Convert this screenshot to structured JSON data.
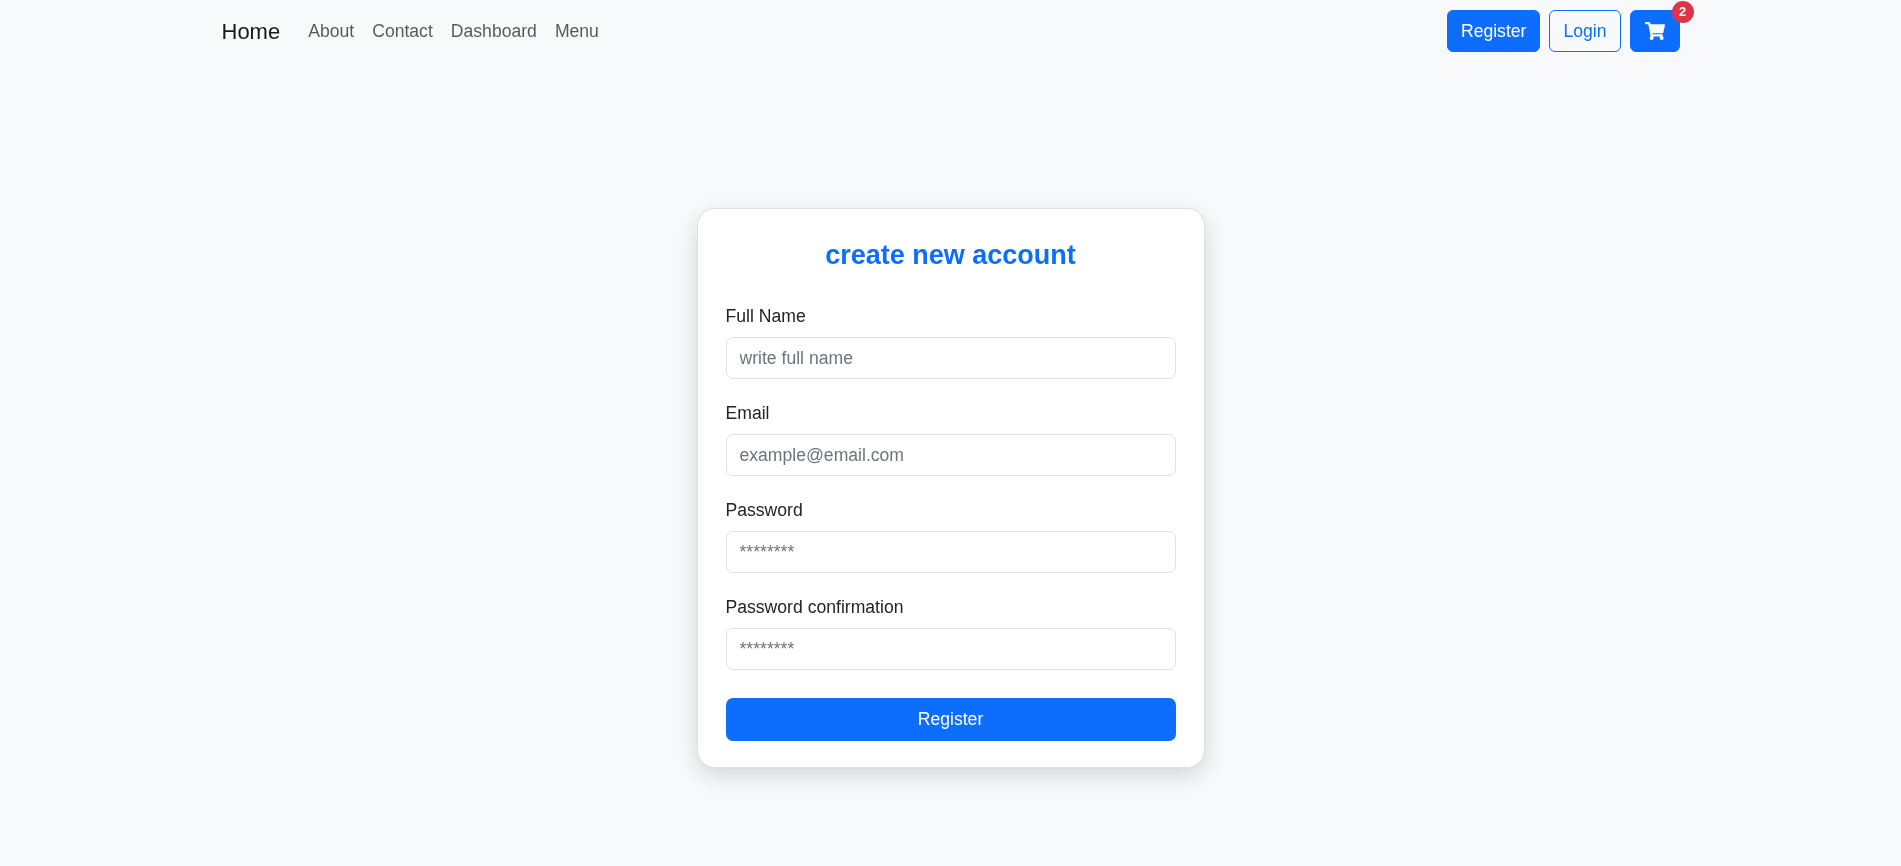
{
  "navbar": {
    "brand": "Home",
    "links": [
      "About",
      "Contact",
      "Dashboard",
      "Menu"
    ],
    "buttons": [
      {
        "label": "Register",
        "kind": "primary"
      },
      {
        "label": "Login",
        "kind": "outline"
      }
    ],
    "cart": {
      "badge": "2"
    }
  },
  "form": {
    "title": "create new account",
    "fields": [
      {
        "label": "Full Name",
        "placeholder": "write full name"
      },
      {
        "label": "Email",
        "placeholder": "example@email.com"
      },
      {
        "label": "Password",
        "placeholder": "********"
      },
      {
        "label": "Password confirmation",
        "placeholder": "********"
      }
    ],
    "submit": "Register"
  }
}
